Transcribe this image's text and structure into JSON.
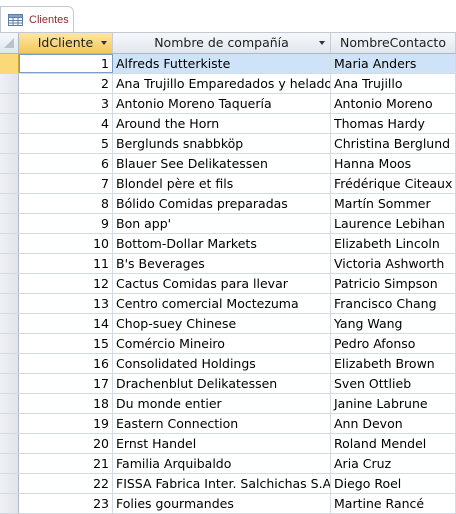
{
  "tab": {
    "label": "Clientes",
    "icon": "table-icon"
  },
  "columns": [
    {
      "label": "IdCliente",
      "has_dropdown": true,
      "selected": true
    },
    {
      "label": "Nombre de compañía",
      "has_dropdown": true,
      "selected": false
    },
    {
      "label": "NombreContacto",
      "has_dropdown": false,
      "selected": false
    }
  ],
  "current_row_index": 0,
  "rows": [
    {
      "id": "1",
      "company": "Alfreds Futterkiste",
      "contact": "Maria Anders"
    },
    {
      "id": "2",
      "company": "Ana Trujillo Emparedados y helados",
      "contact": "Ana Trujillo"
    },
    {
      "id": "3",
      "company": "Antonio Moreno Taquería",
      "contact": "Antonio Moreno"
    },
    {
      "id": "4",
      "company": "Around the Horn",
      "contact": "Thomas Hardy"
    },
    {
      "id": "5",
      "company": "Berglunds snabbköp",
      "contact": "Christina Berglund"
    },
    {
      "id": "6",
      "company": "Blauer See Delikatessen",
      "contact": "Hanna Moos"
    },
    {
      "id": "7",
      "company": "Blondel père et fils",
      "contact": "Frédérique Citeaux"
    },
    {
      "id": "8",
      "company": "Bólido Comidas preparadas",
      "contact": "Martín Sommer"
    },
    {
      "id": "9",
      "company": "Bon app'",
      "contact": "Laurence Lebihan"
    },
    {
      "id": "10",
      "company": "Bottom-Dollar Markets",
      "contact": "Elizabeth Lincoln"
    },
    {
      "id": "11",
      "company": "B's Beverages",
      "contact": "Victoria Ashworth"
    },
    {
      "id": "12",
      "company": "Cactus Comidas para llevar",
      "contact": "Patricio Simpson"
    },
    {
      "id": "13",
      "company": "Centro comercial Moctezuma",
      "contact": "Francisco Chang"
    },
    {
      "id": "14",
      "company": "Chop-suey Chinese",
      "contact": "Yang Wang"
    },
    {
      "id": "15",
      "company": "Comércio Mineiro",
      "contact": "Pedro Afonso"
    },
    {
      "id": "16",
      "company": "Consolidated Holdings",
      "contact": "Elizabeth Brown"
    },
    {
      "id": "17",
      "company": "Drachenblut Delikatessen",
      "contact": "Sven Ottlieb"
    },
    {
      "id": "18",
      "company": "Du monde entier",
      "contact": "Janine Labrune"
    },
    {
      "id": "19",
      "company": "Eastern Connection",
      "contact": "Ann Devon"
    },
    {
      "id": "20",
      "company": "Ernst Handel",
      "contact": "Roland Mendel"
    },
    {
      "id": "21",
      "company": "Familia Arquibaldo",
      "contact": "Aria Cruz"
    },
    {
      "id": "22",
      "company": "FISSA Fabrica Inter. Salchichas S.A.",
      "contact": "Diego Roel"
    },
    {
      "id": "23",
      "company": "Folies gourmandes",
      "contact": "Martine Rancé"
    }
  ],
  "colors": {
    "selection": "#cfe3f8",
    "header_selected": "#f6c75a",
    "tab_text": "#8b2d2d"
  }
}
